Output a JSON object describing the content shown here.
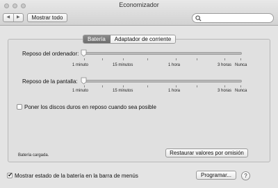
{
  "window": {
    "title": "Economizador"
  },
  "toolbar": {
    "back_glyph": "◀",
    "forward_glyph": "▶",
    "show_all_label": "Mostrar todo",
    "search_placeholder": ""
  },
  "tabs": [
    {
      "label": "Batería",
      "selected": true
    },
    {
      "label": "Adaptador de corriente",
      "selected": false
    }
  ],
  "computer_sleep": {
    "label": "Reposo del ordenador:",
    "ticks": [
      "1 minuto",
      "15 minutos",
      "1 hora",
      "3 horas",
      "Nunca"
    ],
    "value": "1 minuto"
  },
  "display_sleep": {
    "label": "Reposo de la pantalla:",
    "ticks": [
      "1 minuto",
      "15 minutos",
      "1 hora",
      "3 horas",
      "Nunca"
    ],
    "value": "1 minuto"
  },
  "disk_sleep": {
    "label": "Poner los discos duros en reposo cuando sea posible",
    "checked": false
  },
  "status": {
    "text": "Batería cargada."
  },
  "restore_label": "Restaurar valores por omisión",
  "menu_bar_battery": {
    "label": "Mostrar estado de la batería en la barra de menús",
    "checked": true
  },
  "schedule_label": "Programar...",
  "help_label": "?"
}
